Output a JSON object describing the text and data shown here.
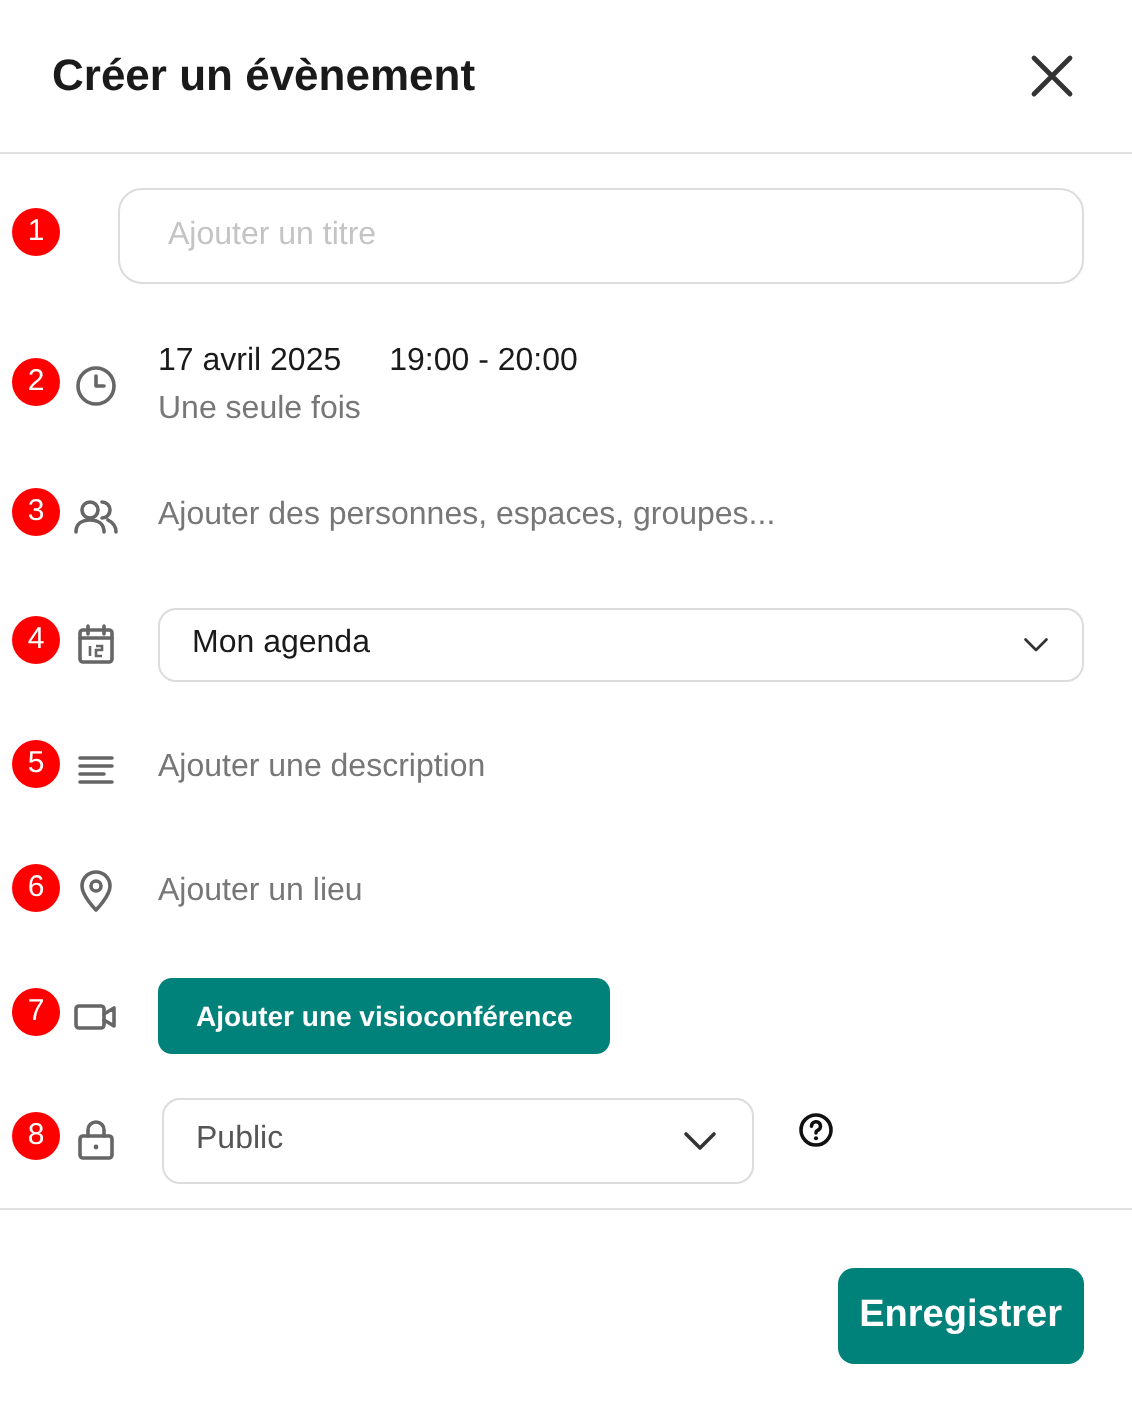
{
  "header": {
    "title": "Créer un évènement"
  },
  "rows": [
    {
      "marker": "1",
      "kind": "title",
      "placeholder": "Ajouter un titre"
    },
    {
      "marker": "2",
      "kind": "datetime",
      "date": "17 avril 2025",
      "time": "19:00 - 20:00",
      "recurrence": "Une seule fois"
    },
    {
      "marker": "3",
      "kind": "text",
      "placeholder": "Ajouter des personnes, espaces, groupes..."
    },
    {
      "marker": "4",
      "kind": "select",
      "value": "Mon agenda"
    },
    {
      "marker": "5",
      "kind": "text",
      "placeholder": "Ajouter une description"
    },
    {
      "marker": "6",
      "kind": "text",
      "placeholder": "Ajouter un lieu"
    },
    {
      "marker": "7",
      "kind": "button",
      "label": "Ajouter une visioconférence"
    },
    {
      "marker": "8",
      "kind": "select",
      "value": "Public",
      "help": true
    }
  ],
  "footer": {
    "save": "Enregistrer"
  }
}
